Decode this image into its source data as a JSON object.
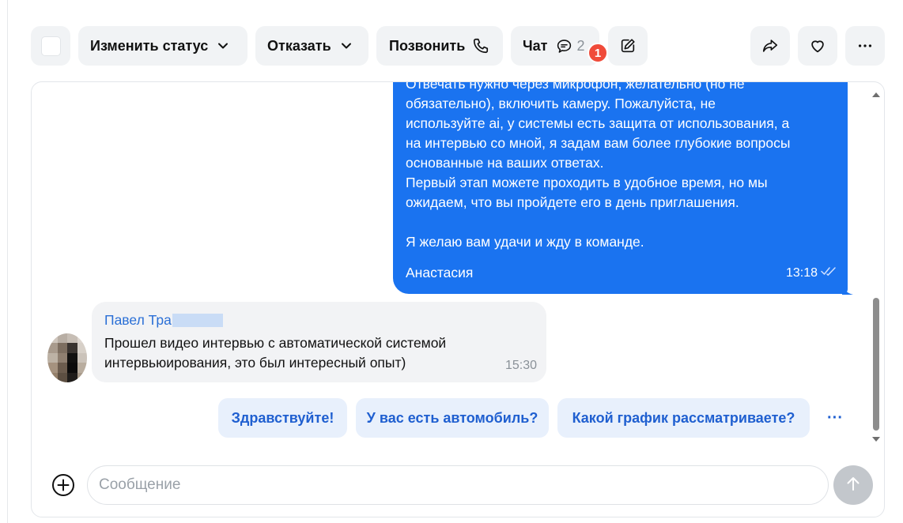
{
  "toolbar": {
    "change_status_label": "Изменить статус",
    "reject_label": "Отказать",
    "call_label": "Позвонить",
    "chat_label": "Чат",
    "chat_count": "2",
    "chat_badge": "1"
  },
  "outgoing_message": {
    "lines": [
      "Отвечать нужно через микрофон, желательно (но не",
      "обязательно), включить камеру. Пожалуйста, не",
      "используйте ai, у системы есть защита от использования, а",
      "на интервью со мной, я задам вам более глубокие вопросы",
      "основанные на ваших ответах.",
      "Первый этап можете проходить в удобное время, но мы",
      "ожидаем, что вы пройдете его в день приглашения.",
      "Я желаю вам удачи и жду в команде."
    ],
    "sender": "Анастасия",
    "time": "13:18"
  },
  "incoming_message": {
    "sender": "Павел Тра",
    "lines": [
      "Прошел видео интервью с автоматической системой",
      "интервьюирования, это был интересный опыт)"
    ],
    "time": "15:30"
  },
  "quick_replies": [
    "Здравствуйте!",
    "У вас есть автомобиль?",
    "Какой график рассматриваете?"
  ],
  "quick_more": "···",
  "composer": {
    "placeholder": "Сообщение"
  },
  "colors": {
    "outgoing_bubble": "#1a73f0",
    "incoming_bubble": "#f2f3f5",
    "quick_reply_bg": "#e8f0fc",
    "quick_reply_text": "#1f5fd0",
    "badge": "#f04b3a",
    "send_disabled": "#c3c7cc"
  },
  "icons": {
    "status_chevron": "chevron-down-icon",
    "reject_chevron": "chevron-down-icon",
    "call": "phone-icon",
    "chat": "chat-bubble-icon",
    "edit": "pencil-icon",
    "share": "share-arrow-icon",
    "like": "heart-icon",
    "more": "more-dots-icon",
    "add": "plus-circle-icon",
    "send": "arrow-up-icon",
    "read": "double-check-icon"
  }
}
